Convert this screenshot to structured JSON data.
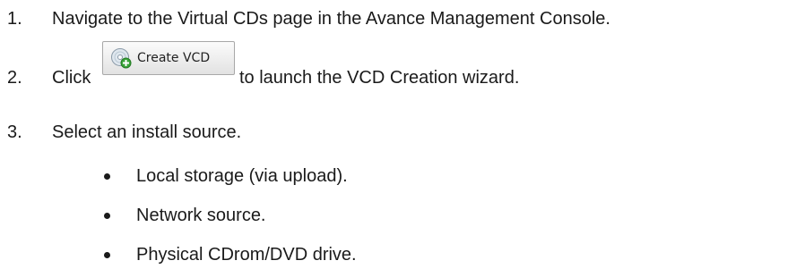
{
  "steps": [
    {
      "number": "1.",
      "text": "Navigate to the Virtual CDs page in the Avance Management Console."
    },
    {
      "number": "2.",
      "text_before": "Click",
      "button_label": "Create VCD",
      "text_after": "to launch the VCD Creation wizard."
    },
    {
      "number": "3.",
      "text": "Select an install source."
    }
  ],
  "bullets": [
    "Local storage (via upload).",
    "Network source.",
    "Physical CDrom/DVD drive."
  ],
  "icons": {
    "button_icon": "cd-add-icon"
  }
}
